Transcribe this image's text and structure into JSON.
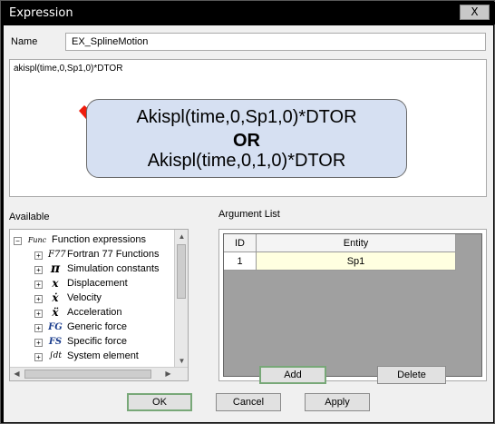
{
  "window": {
    "title": "Expression",
    "close_label": "X"
  },
  "name": {
    "label": "Name",
    "value": "EX_SplineMotion"
  },
  "expression": {
    "text": "akispl(time,0,Sp1,0)*DTOR",
    "callout": {
      "line1": "Akispl(time,0,Sp1,0)*DTOR",
      "line2": "OR",
      "line3": "Akispl(time,0,1,0)*DTOR"
    },
    "arrow_color": "#ee1c0c"
  },
  "available": {
    "label": "Available",
    "root": {
      "icon": "Func",
      "label": "Function expressions"
    },
    "items": [
      {
        "icon": "F77",
        "label": "Fortran 77 Functions"
      },
      {
        "icon": "π",
        "label": "Simulation constants"
      },
      {
        "icon": "x",
        "label": "Displacement"
      },
      {
        "icon": "ẋ",
        "label": "Velocity"
      },
      {
        "icon": "ẍ",
        "label": "Acceleration"
      },
      {
        "icon": "FG",
        "label": "Generic force"
      },
      {
        "icon": "FS",
        "label": "Specific force"
      },
      {
        "icon": "∫dt",
        "label": "System element"
      }
    ]
  },
  "arguments": {
    "label": "Argument List",
    "columns": [
      "ID",
      "Entity"
    ],
    "rows": [
      {
        "id": "1",
        "entity": "Sp1"
      }
    ],
    "selected_color": "#ffffe0"
  },
  "buttons": {
    "add": "Add",
    "delete": "Delete",
    "ok": "OK",
    "cancel": "Cancel",
    "apply": "Apply"
  }
}
